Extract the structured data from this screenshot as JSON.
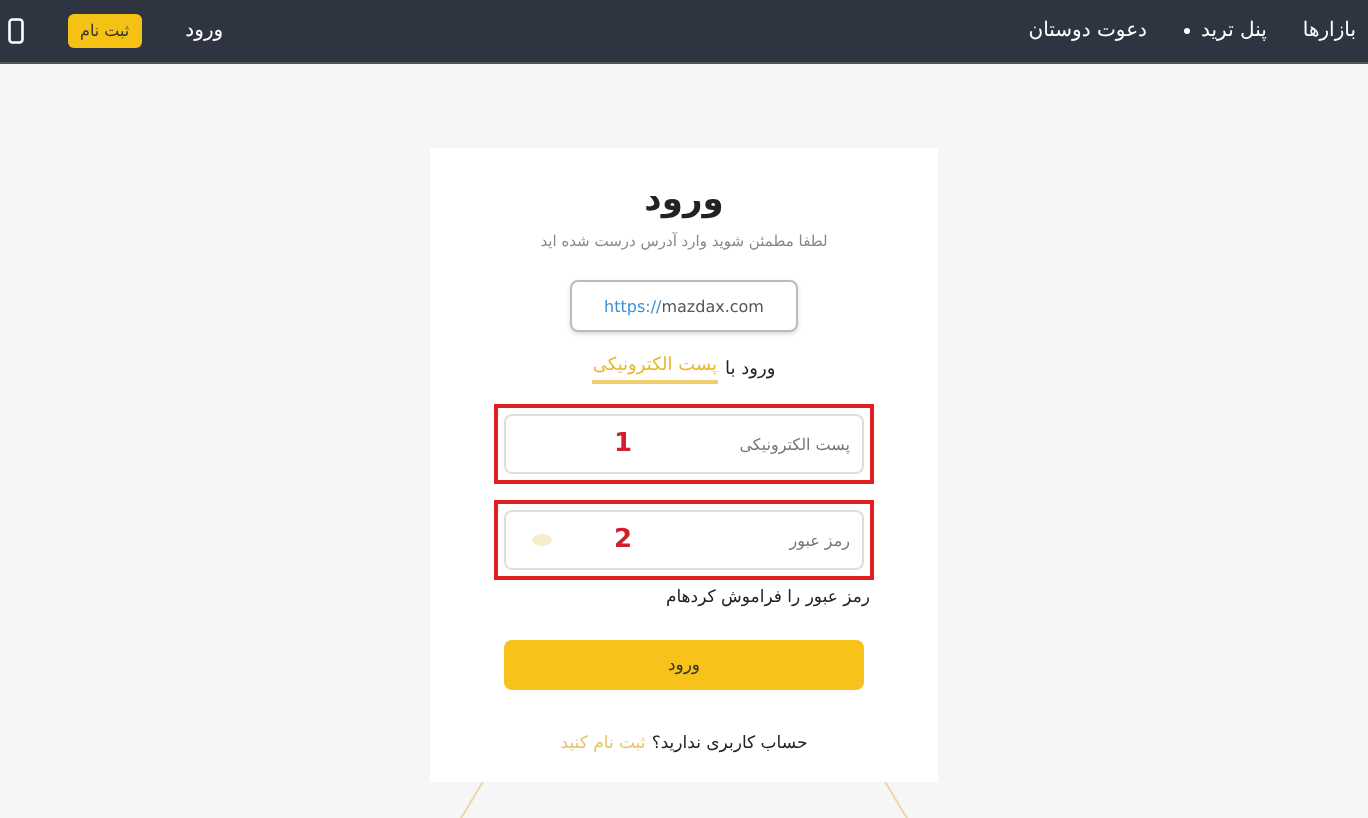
{
  "navbar": {
    "links": [
      {
        "label": "بازارها",
        "dropdown": false
      },
      {
        "label": "پنل ترید",
        "dropdown": true
      },
      {
        "label": "دعوت دوستان",
        "dropdown": false
      }
    ],
    "login": "ورود",
    "signup": "ثبت نام"
  },
  "card": {
    "title": "ورود",
    "subtitle": "لطفا مطمئن شوید وارد آدرس درست شده اید",
    "url": {
      "scheme": "https://",
      "host": "mazdax.com"
    },
    "method": {
      "prefix": "ورود با",
      "label": "پست الکترونیکی"
    },
    "fields": [
      {
        "placeholder": "پست الکترونیکی",
        "kind": "text",
        "annotation": "1"
      },
      {
        "placeholder": "رمز عبور",
        "kind": "password",
        "annotation": "2"
      }
    ],
    "forgot": "رمز عبور را فراموش کردهام",
    "submit": "ورود",
    "signup_prompt": "حساب کاربری ندارید؟",
    "signup_link": "ثبت نام کنید"
  }
}
